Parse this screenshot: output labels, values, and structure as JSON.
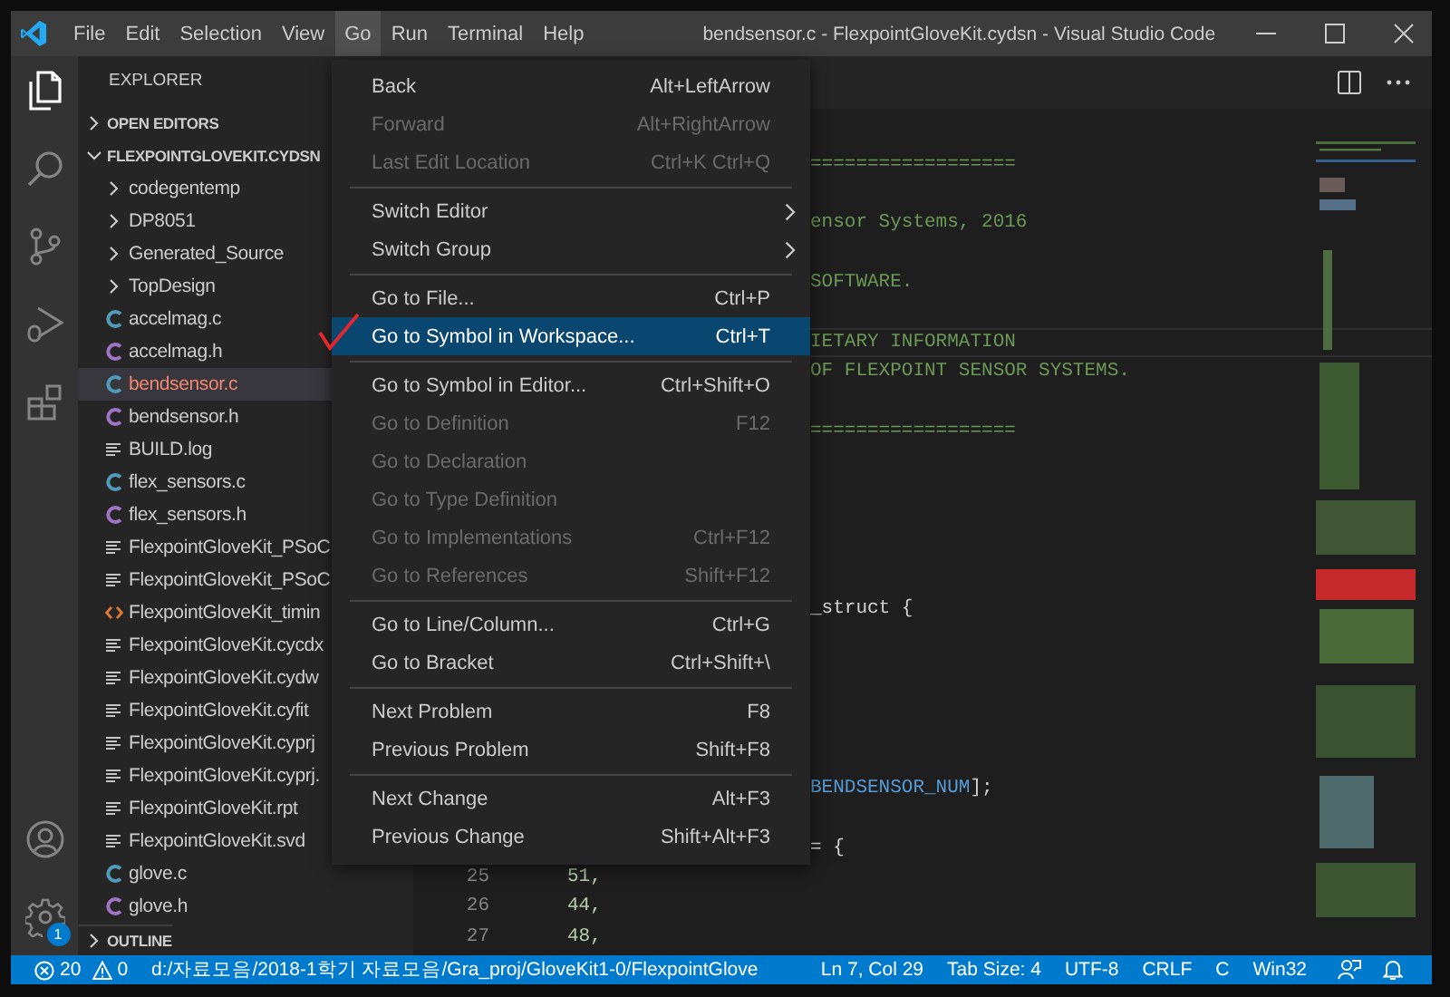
{
  "window": {
    "title": "bendsensor.c - FlexpointGloveKit.cydsn - Visual Studio Code"
  },
  "menubar": [
    {
      "label": "File",
      "selected": false
    },
    {
      "label": "Edit",
      "selected": false
    },
    {
      "label": "Selection",
      "selected": false
    },
    {
      "label": "View",
      "selected": false
    },
    {
      "label": "Go",
      "selected": true
    },
    {
      "label": "Run",
      "selected": false
    },
    {
      "label": "Terminal",
      "selected": false
    },
    {
      "label": "Help",
      "selected": false
    }
  ],
  "activity_bar": {
    "settings_badge": "1"
  },
  "sidebar": {
    "title": "EXPLORER",
    "sections": [
      {
        "label": "OPEN EDITORS",
        "expanded": false
      },
      {
        "label": "FLEXPOINTGLOVEKIT.CYDSN",
        "expanded": true
      }
    ],
    "items": [
      {
        "label": "codegentemp",
        "kind": "folder",
        "selected": false,
        "error": false
      },
      {
        "label": "DP8051",
        "kind": "folder",
        "selected": false,
        "error": false
      },
      {
        "label": "Generated_Source",
        "kind": "folder",
        "selected": false,
        "error": false
      },
      {
        "label": "TopDesign",
        "kind": "folder",
        "selected": false,
        "error": false
      },
      {
        "label": "accelmag.c",
        "kind": "c",
        "selected": false,
        "error": false
      },
      {
        "label": "accelmag.h",
        "kind": "h",
        "selected": false,
        "error": false
      },
      {
        "label": "bendsensor.c",
        "kind": "c",
        "selected": true,
        "error": true
      },
      {
        "label": "bendsensor.h",
        "kind": "h",
        "selected": false,
        "error": false
      },
      {
        "label": "BUILD.log",
        "kind": "text",
        "selected": false,
        "error": false
      },
      {
        "label": "flex_sensors.c",
        "kind": "c",
        "selected": false,
        "error": false
      },
      {
        "label": "flex_sensors.h",
        "kind": "h",
        "selected": false,
        "error": false
      },
      {
        "label": "FlexpointGloveKit_PSoC",
        "kind": "text",
        "selected": false,
        "error": false
      },
      {
        "label": "FlexpointGloveKit_PSoC",
        "kind": "text",
        "selected": false,
        "error": false
      },
      {
        "label": "FlexpointGloveKit_timin",
        "kind": "xml",
        "selected": false,
        "error": false
      },
      {
        "label": "FlexpointGloveKit.cycdx",
        "kind": "text",
        "selected": false,
        "error": false
      },
      {
        "label": "FlexpointGloveKit.cydw",
        "kind": "text",
        "selected": false,
        "error": false
      },
      {
        "label": "FlexpointGloveKit.cyfit",
        "kind": "text",
        "selected": false,
        "error": false
      },
      {
        "label": "FlexpointGloveKit.cyprj",
        "kind": "text",
        "selected": false,
        "error": false
      },
      {
        "label": "FlexpointGloveKit.cyprj.",
        "kind": "text",
        "selected": false,
        "error": false
      },
      {
        "label": "FlexpointGloveKit.rpt",
        "kind": "text",
        "selected": false,
        "error": false
      },
      {
        "label": "FlexpointGloveKit.svd",
        "kind": "text",
        "selected": false,
        "error": false
      },
      {
        "label": "glove.c",
        "kind": "c",
        "selected": false,
        "error": false
      },
      {
        "label": "glove.h",
        "kind": "h",
        "selected": false,
        "error": false
      }
    ],
    "footer_section": {
      "label": "OUTLINE",
      "expanded": false
    }
  },
  "go_menu": [
    {
      "kind": "item",
      "label": "Back",
      "shortcut": "Alt+LeftArrow",
      "disabled": false,
      "selected": false,
      "submenu": false
    },
    {
      "kind": "item",
      "label": "Forward",
      "shortcut": "Alt+RightArrow",
      "disabled": true,
      "selected": false,
      "submenu": false
    },
    {
      "kind": "item",
      "label": "Last Edit Location",
      "shortcut": "Ctrl+K Ctrl+Q",
      "disabled": true,
      "selected": false,
      "submenu": false
    },
    {
      "kind": "separator"
    },
    {
      "kind": "item",
      "label": "Switch Editor",
      "disabled": false,
      "selected": false,
      "submenu": true
    },
    {
      "kind": "item",
      "label": "Switch Group",
      "disabled": false,
      "selected": false,
      "submenu": true
    },
    {
      "kind": "separator"
    },
    {
      "kind": "item",
      "label": "Go to File...",
      "shortcut": "Ctrl+P",
      "disabled": false,
      "selected": false,
      "submenu": false
    },
    {
      "kind": "item",
      "label": "Go to Symbol in Workspace...",
      "shortcut": "Ctrl+T",
      "disabled": false,
      "selected": true,
      "submenu": false
    },
    {
      "kind": "separator"
    },
    {
      "kind": "item",
      "label": "Go to Symbol in Editor...",
      "shortcut": "Ctrl+Shift+O",
      "disabled": false,
      "selected": false,
      "submenu": false
    },
    {
      "kind": "item",
      "label": "Go to Definition",
      "shortcut": "F12",
      "disabled": true,
      "selected": false,
      "submenu": false
    },
    {
      "kind": "item",
      "label": "Go to Declaration",
      "disabled": true,
      "selected": false,
      "submenu": false
    },
    {
      "kind": "item",
      "label": "Go to Type Definition",
      "disabled": true,
      "selected": false,
      "submenu": false
    },
    {
      "kind": "item",
      "label": "Go to Implementations",
      "shortcut": "Ctrl+F12",
      "disabled": true,
      "selected": false,
      "submenu": false
    },
    {
      "kind": "item",
      "label": "Go to References",
      "shortcut": "Shift+F12",
      "disabled": true,
      "selected": false,
      "submenu": false
    },
    {
      "kind": "separator"
    },
    {
      "kind": "item",
      "label": "Go to Line/Column...",
      "shortcut": "Ctrl+G",
      "disabled": false,
      "selected": false,
      "submenu": false
    },
    {
      "kind": "item",
      "label": "Go to Bracket",
      "shortcut": "Ctrl+Shift+\\",
      "disabled": false,
      "selected": false,
      "submenu": false
    },
    {
      "kind": "separator"
    },
    {
      "kind": "item",
      "label": "Next Problem",
      "shortcut": "F8",
      "disabled": false,
      "selected": false,
      "submenu": false
    },
    {
      "kind": "item",
      "label": "Previous Problem",
      "shortcut": "Shift+F8",
      "disabled": false,
      "selected": false,
      "submenu": false
    },
    {
      "kind": "separator"
    },
    {
      "kind": "item",
      "label": "Next Change",
      "shortcut": "Alt+F3",
      "disabled": false,
      "selected": false,
      "submenu": false
    },
    {
      "kind": "item",
      "label": "Previous Change",
      "shortcut": "Shift+Alt+F3",
      "disabled": false,
      "selected": false,
      "submenu": false
    }
  ],
  "editor": {
    "fragments": [
      {
        "current": false,
        "parts": [
          {
            "text": "==================",
            "kind": "comment"
          }
        ]
      },
      {
        "current": false,
        "parts": [
          {
            "text": "ensor Systems, 2016",
            "kind": "comment"
          }
        ]
      },
      {
        "current": false,
        "parts": [
          {
            "text": "SOFTWARE.",
            "kind": "comment"
          }
        ]
      },
      {
        "current": true,
        "parts": [
          {
            "text": "IETARY INFORMATION",
            "kind": "comment"
          }
        ]
      },
      {
        "current": false,
        "parts": [
          {
            "text": "OF FLEXPOINT SENSOR SYSTEMS.",
            "kind": "comment"
          }
        ]
      },
      {
        "current": false,
        "parts": [
          {
            "text": "==================",
            "kind": "comment"
          }
        ]
      },
      {
        "current": false,
        "parts": [
          {
            "text": "_struct {",
            "kind": "plain"
          }
        ]
      },
      {
        "current": false,
        "parts": [
          {
            "text": "BENDSENSOR_NUM",
            "kind": "macro"
          },
          {
            "text": "];",
            "kind": "plain"
          }
        ]
      },
      {
        "current": false,
        "parts": [
          {
            "text": "= {",
            "kind": "plain"
          }
        ]
      }
    ],
    "lines": [
      {
        "number": "25",
        "code": "51,"
      },
      {
        "number": "26",
        "code": "44,"
      },
      {
        "number": "27",
        "code": "48,"
      }
    ]
  },
  "status_bar": {
    "errors": "20",
    "warnings": "0",
    "path": "d:/자료모음/2018-1학기 자료모음/Gra_proj/GloveKit1-0/FlexpointGlove",
    "items": [
      "Ln 7, Col 29",
      "Tab Size: 4",
      "UTF-8",
      "CRLF",
      "C",
      "Win32"
    ]
  }
}
